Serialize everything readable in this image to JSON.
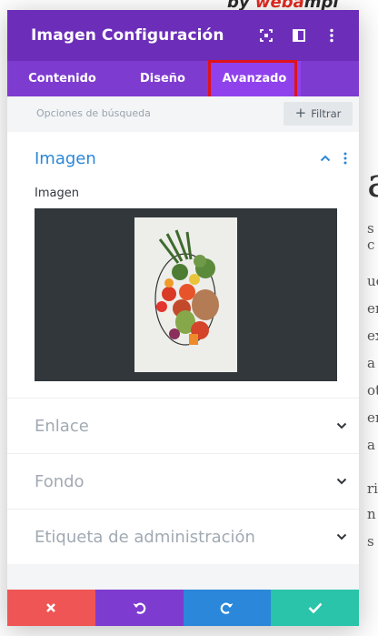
{
  "background": {
    "brand_prefix": "by ",
    "brand_red": "weba",
    "brand_suffix": "mpl",
    "big_letter": "a",
    "text_fragments": [
      "s c",
      "ue",
      "er",
      "ex",
      "a",
      "ot",
      "er",
      "a",
      "ri",
      "n",
      "s"
    ]
  },
  "header": {
    "title": "Imagen Configuración",
    "icons": [
      "expand-icon",
      "split-view-icon",
      "more-vertical-icon"
    ]
  },
  "tabs": [
    {
      "label": "Contenido",
      "active": false
    },
    {
      "label": "Diseño",
      "active": false
    },
    {
      "label": "Avanzado",
      "active": true
    }
  ],
  "search": {
    "placeholder": "Opciones de búsqueda",
    "filter_label": "Filtrar"
  },
  "sections": {
    "open": {
      "title": "Imagen",
      "field_label": "Imagen",
      "image_alt": "Cesta con verduras"
    },
    "closed": [
      {
        "title": "Enlace"
      },
      {
        "title": "Fondo"
      },
      {
        "title": "Etiqueta de administración"
      }
    ]
  },
  "colors": {
    "header": "#6c2eb9",
    "tabs": "#7e3bd0",
    "active_tab": "#8f42ec",
    "highlight": "#e0121b",
    "accent_blue": "#2b87da",
    "cancel": "#ef5555",
    "undo": "#7e3bd0",
    "redo": "#2b87da",
    "save": "#29c4a9"
  },
  "footer": {
    "buttons": [
      "close-icon",
      "undo-icon",
      "redo-icon",
      "check-icon"
    ]
  }
}
